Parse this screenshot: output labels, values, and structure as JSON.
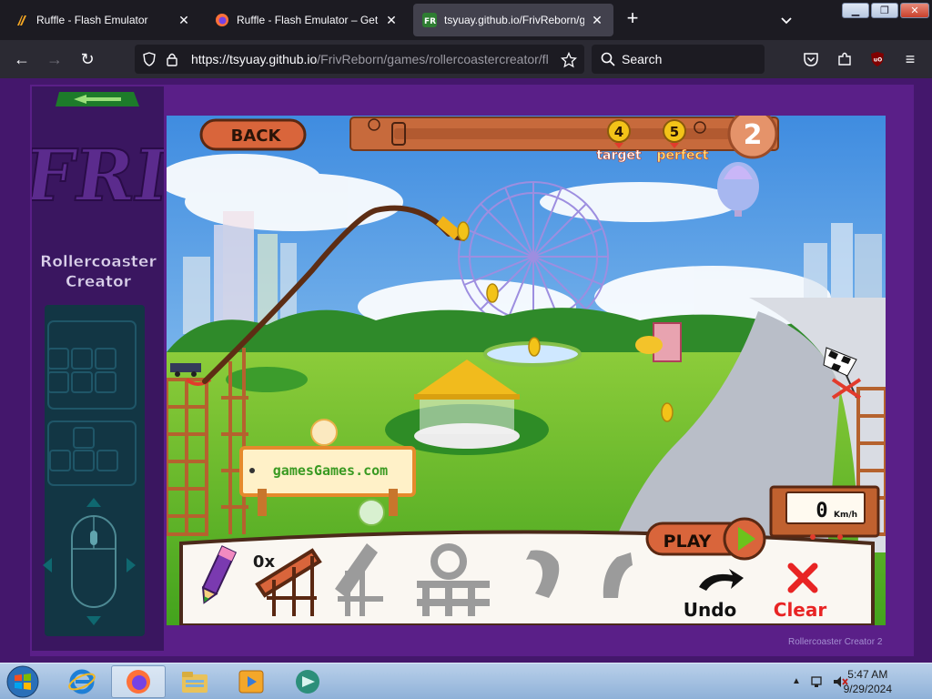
{
  "browser": {
    "tabs": [
      {
        "title": "Ruffle - Flash Emulator",
        "icon": "ruffle-favicon",
        "active": false
      },
      {
        "title": "Ruffle - Flash Emulator – Get th",
        "icon": "firefox-favicon",
        "active": false
      },
      {
        "title": "tsyuay.github.io/FrivReborn/ga",
        "icon": "friv-favicon",
        "active": true
      }
    ],
    "url_host": "https://tsyuay.github.io",
    "url_path": "/FrivReborn/games/rollercoastercreator/fl",
    "search_placeholder": "Search"
  },
  "sidebar": {
    "game_title_line1": "Rollercoaster",
    "game_title_line2": "Creator"
  },
  "game": {
    "back_label": "BACK",
    "target_label": "target",
    "perfect_label": "perfect",
    "target_value": "4",
    "perfect_value": "5",
    "level_number": "2",
    "speed_value": "0",
    "speed_unit": "Km/h",
    "sign_text": "gamesGames.com",
    "play_label": "PLAY",
    "pieces_count": "0x",
    "undo_label": "Undo",
    "clear_label": "Clear",
    "credit": "Rollercoaster Creator 2"
  },
  "taskbar": {
    "time": "5:47 AM",
    "date": "9/29/2024"
  },
  "colors": {
    "accent_orange": "#d9653b",
    "coin_gold": "#f3c318",
    "clear_red": "#e82424",
    "play_green": "#6cc21c"
  }
}
